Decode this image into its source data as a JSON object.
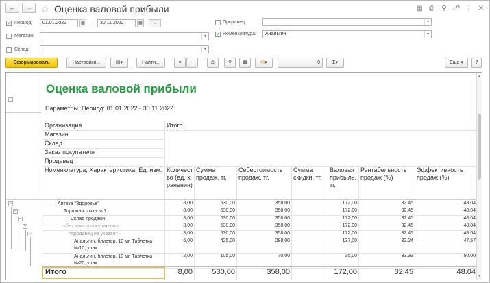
{
  "window": {
    "title": "Оценка валовой прибыли"
  },
  "filters": {
    "period": {
      "label": "Период:",
      "checked": true,
      "from": "01.01.2022",
      "dash": "–",
      "to": "30.11.2022",
      "more": "..."
    },
    "store": {
      "label": "Магазин:",
      "checked": false,
      "value": ""
    },
    "warehouse": {
      "label": "Склад:",
      "checked": false,
      "value": ""
    },
    "seller": {
      "label": "Продавец:",
      "checked": false,
      "value": ""
    },
    "nomenclature": {
      "label": "Номенклатура:",
      "checked": true,
      "value": "Анальгин"
    }
  },
  "toolbar": {
    "generate": "Сформировать",
    "settings": "Настройки...",
    "find": "Найти...",
    "sum": "0",
    "more": "Еще"
  },
  "report": {
    "title": "Оценка валовой прибыли",
    "params": "Параметры:   Период: 01.01.2022 - 30.11.2022",
    "dims": [
      "Организация",
      "Магазин",
      "Склад",
      "Заказ покупателя",
      "Продавец",
      "Номенклатура, Характеристика, Ед. изм."
    ],
    "total_header": "Итого",
    "columns": [
      "Количество (ед. хранения)",
      "Сумма продаж, тг.",
      "Себестоимость продаж, тг.",
      "Сумма скидки, тг.",
      "Валовая прибыль, тг.",
      "Рентабельность продаж (%)",
      "Эффективность продаж (%)"
    ],
    "rows": [
      {
        "name": "Аптека \"Здоровье\"",
        "qty": "8,00",
        "sales": "530,00",
        "cost": "358,00",
        "disc": "",
        "gross": "172,00",
        "rent": "32.45",
        "eff": "48.04"
      },
      {
        "name": "Торговая точка №1",
        "qty": "8,00",
        "sales": "530,00",
        "cost": "358,00",
        "disc": "",
        "gross": "172,00",
        "rent": "32.45",
        "eff": "48.04"
      },
      {
        "name": "Склад продажи",
        "qty": "8,00",
        "sales": "530,00",
        "cost": "358,00",
        "disc": "",
        "gross": "172,00",
        "rent": "32.45",
        "eff": "48.04"
      },
      {
        "name": "<без заказа покупателя>",
        "qty": "8,00",
        "sales": "530,00",
        "cost": "358,00",
        "disc": "",
        "gross": "172,00",
        "rent": "32.45",
        "eff": "48.04"
      },
      {
        "name": "<продавец не указан>",
        "qty": "8,00",
        "sales": "530,00",
        "cost": "358,00",
        "disc": "",
        "gross": "172,00",
        "rent": "32.45",
        "eff": "48.04"
      },
      {
        "name": "Анальгин, блистер, 10 мг, Таблетка №10, упак",
        "qty": "6,00",
        "sales": "425,00",
        "cost": "288,00",
        "disc": "",
        "gross": "137,00",
        "rent": "32.24",
        "eff": "47.57"
      },
      {
        "name": "Анальгин, блистер, 10 мг, Таблетка №20, упак",
        "qty": "2,00",
        "sales": "105,00",
        "cost": "70,00",
        "disc": "",
        "gross": "35,00",
        "rent": "33.33",
        "eff": "50.00"
      }
    ],
    "total": {
      "label": "Итого",
      "qty": "8,00",
      "sales": "530,00",
      "cost": "358,00",
      "disc": "",
      "gross": "172,00",
      "rent": "32.45",
      "eff": "48.04"
    }
  },
  "colors": {
    "title": "#1f9f3f",
    "accent": "#f5c400"
  }
}
